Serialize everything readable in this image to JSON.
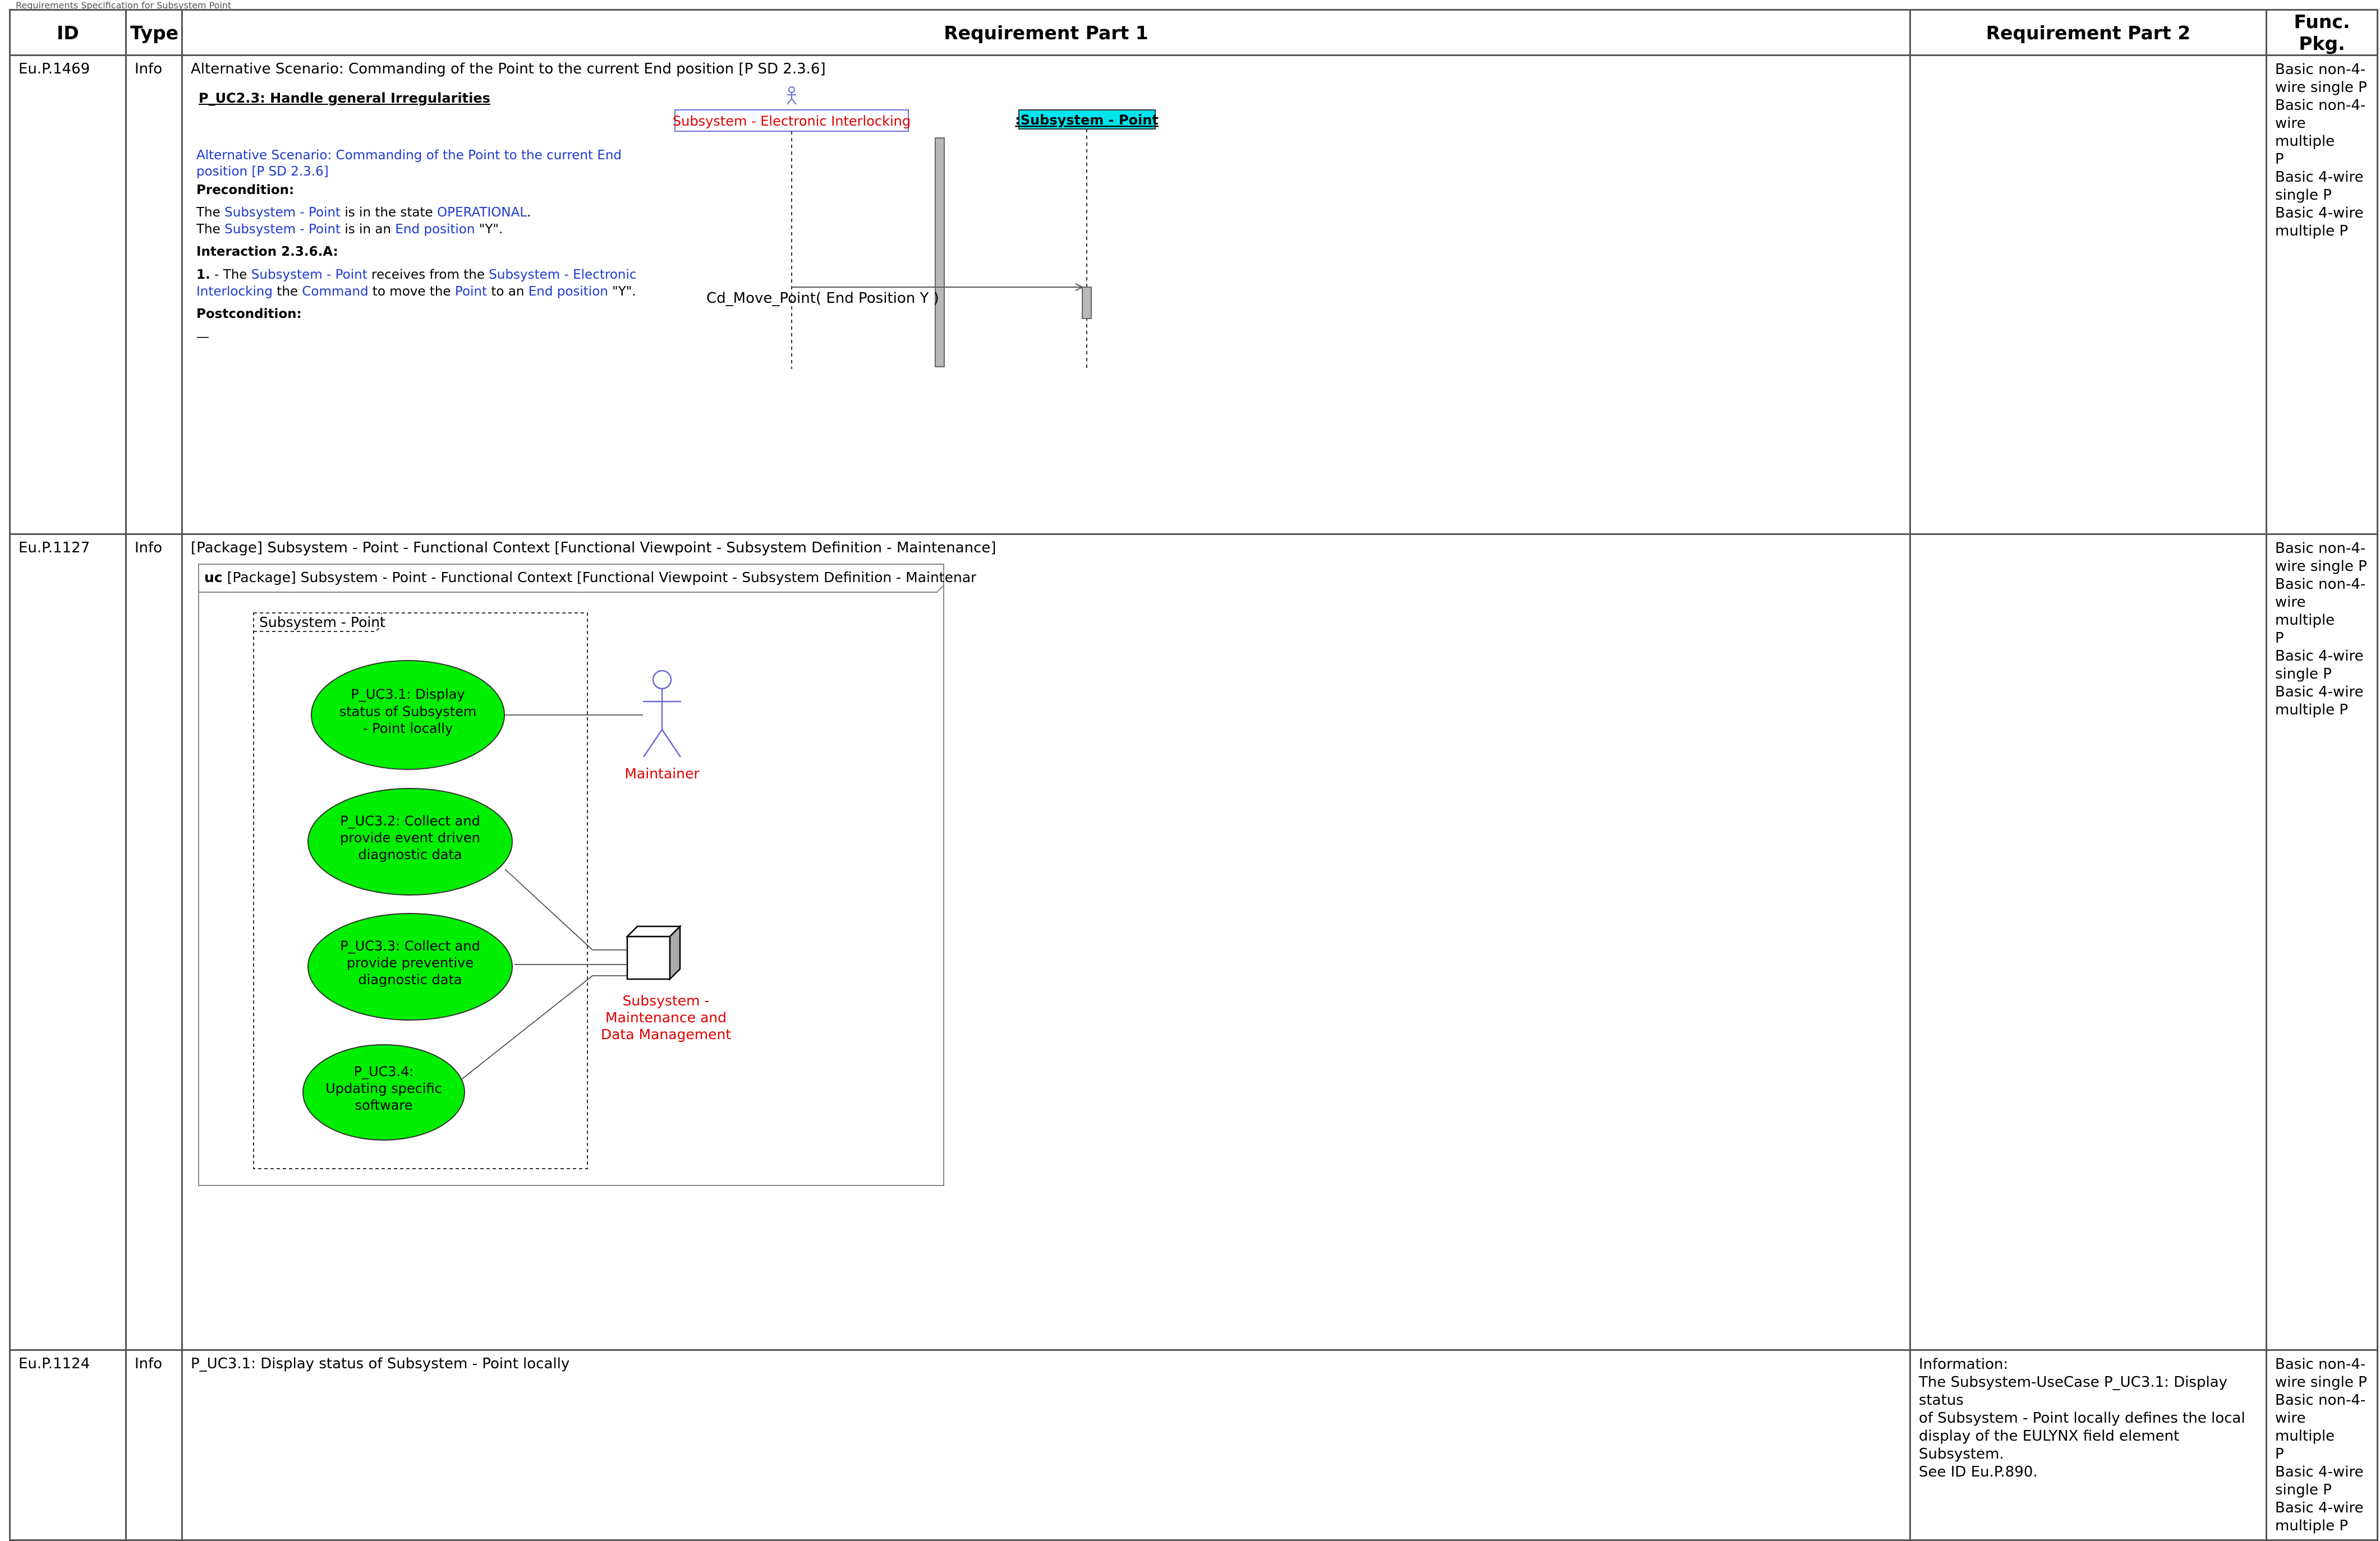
{
  "header": {
    "running_title": "Requirements Specification for Subsystem Point"
  },
  "columns": {
    "id": "ID",
    "type": "Type",
    "part1": "Requirement Part 1",
    "part2": "Requirement Part 2",
    "func_pkg": "Func. Pkg."
  },
  "func_pkg_lines": [
    "Basic non-4-",
    "wire single P",
    "Basic non-4-",
    "wire multiple",
    "P",
    "Basic 4-wire",
    "single P",
    "Basic 4-wire",
    "multiple P"
  ],
  "rows": [
    {
      "id": "Eu.P.1469",
      "type": "Info",
      "title": "Alternative Scenario: Commanding of the Point to the current End position [P SD 2.3.6]",
      "seq": {
        "heading": "P_UC2.3: Handle general Irregularities",
        "scenario_line1": "Alternative Scenario: Commanding of the Point to the current End",
        "scenario_line2": "position [P SD 2.3.6]",
        "precondition_label": "Precondition:",
        "pre1": {
          "a": "The ",
          "b": "Subsystem - Point",
          "c": " is in the state ",
          "d": "OPERATIONAL",
          "e": "."
        },
        "pre2": {
          "a": "The ",
          "b": "Subsystem - Point",
          "c": " is in an ",
          "d": "End position",
          "e": " \"Y\"."
        },
        "interaction_label": "Interaction 2.3.6.A:",
        "int1": {
          "n": "1.",
          "a": " - The ",
          "b": "Subsystem - Point",
          "c": " receives from the ",
          "d": "Subsystem - Electronic"
        },
        "int2": {
          "a": "Interlocking",
          "b": " the ",
          "c": "Command",
          "d": " to move the ",
          "e": "Point",
          "f": " to an ",
          "g": "End position",
          "h": " \"Y\"."
        },
        "postcondition_label": "Postcondition:",
        "post": "—",
        "lifeline1": "Subsystem - Electronic Interlocking",
        "lifeline2": ":Subsystem - Point",
        "message": "Cd_Move_Point( End Position Y )"
      }
    },
    {
      "id": "Eu.P.1127",
      "type": "Info",
      "title": "[Package] Subsystem - Point - Functional Context [Functional Viewpoint - Subsystem Definition -  Maintenance]",
      "uc": {
        "frame_kw": "uc",
        "frame_title": " [Package] Subsystem - Point - Functional Context [Functional Viewpoint - Subsystem Definition -  Maintenance]",
        "boundary": "Subsystem - Point",
        "uc1": [
          "P_UC3.1: Display",
          "status of Subsystem",
          "- Point locally"
        ],
        "uc2": [
          "P_UC3.2: Collect and",
          "provide event driven",
          "diagnostic data"
        ],
        "uc3": [
          "P_UC3.3: Collect and",
          "provide preventive",
          "diagnostic data"
        ],
        "uc4": [
          "P_UC3.4:",
          "Updating specific",
          "software"
        ],
        "actor": "Maintainer",
        "node": [
          "Subsystem -",
          "Maintenance and",
          "Data Management"
        ]
      }
    },
    {
      "id": "Eu.P.1124",
      "type": "Info",
      "title": "P_UC3.1: Display status of Subsystem - Point locally",
      "part2": [
        "Information:",
        "The Subsystem-UseCase P_UC3.1: Display status",
        "of Subsystem - Point locally defines the local",
        "display of the EULYNX field element Subsystem.",
        "See ID Eu.P.890."
      ]
    }
  ],
  "colors": {
    "use_case_fill": "#00ee00",
    "actor_stroke": "#6b6bd6",
    "lifeline_header": "#00e5ee",
    "link": "#1f3ad0",
    "label_red": "#e00000"
  }
}
